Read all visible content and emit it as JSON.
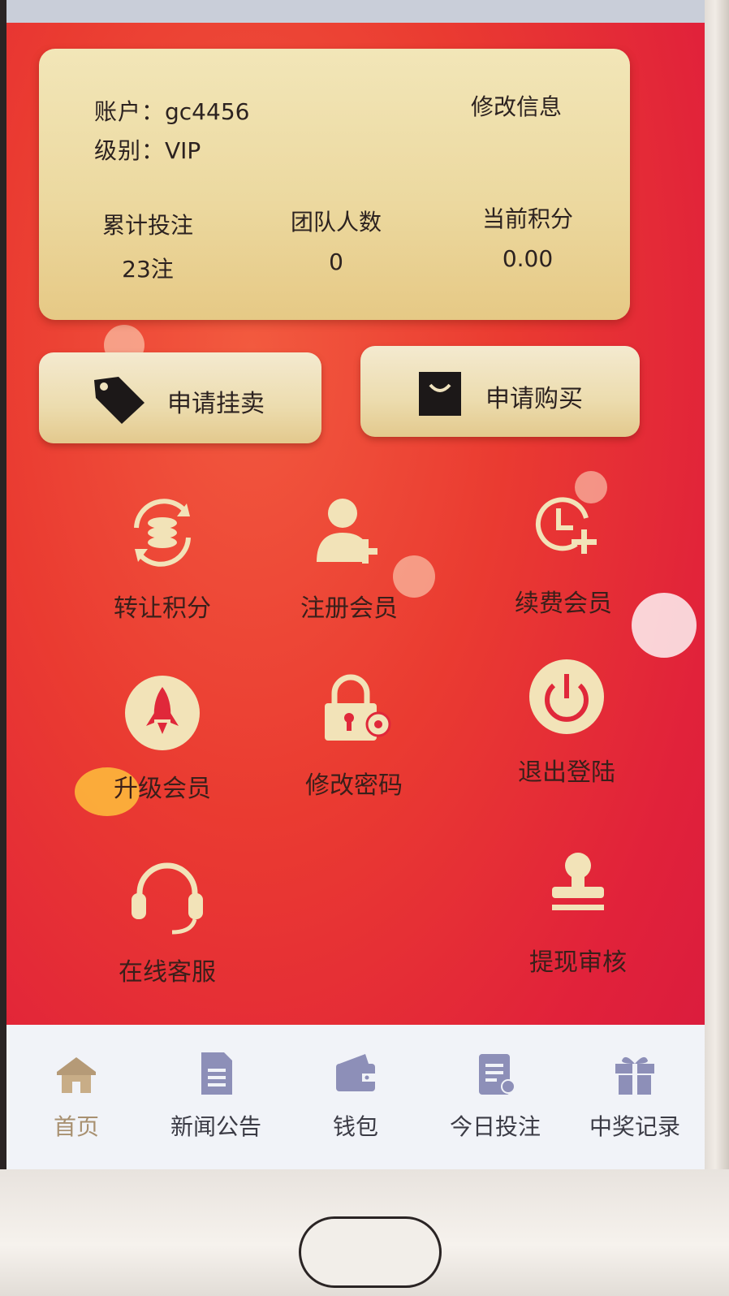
{
  "account": {
    "account_label": "账户：",
    "account_value": "gc4456",
    "level_label": "级别：",
    "level_value": "VIP",
    "edit_link": "修改信息"
  },
  "stats": [
    {
      "label": "累计投注",
      "value": "23注"
    },
    {
      "label": "团队人数",
      "value": "0"
    },
    {
      "label": "当前积分",
      "value": "0.00"
    }
  ],
  "actions": {
    "sell_label": "申请挂卖",
    "buy_label": "申请购买"
  },
  "grid": [
    {
      "label": "转让积分",
      "icon": "transfer-points-icon"
    },
    {
      "label": "注册会员",
      "icon": "register-member-icon"
    },
    {
      "label": "续费会员",
      "icon": "renew-member-icon"
    },
    {
      "label": "升级会员",
      "icon": "rocket-icon"
    },
    {
      "label": "修改密码",
      "icon": "lock-gear-icon"
    },
    {
      "label": "退出登陆",
      "icon": "power-icon"
    },
    {
      "label": "在线客服",
      "icon": "headset-icon"
    },
    {
      "label": "提现审核",
      "icon": "stamp-icon"
    }
  ],
  "nav": [
    {
      "label": "首页",
      "icon": "home-icon",
      "active": true
    },
    {
      "label": "新闻公告",
      "icon": "document-icon"
    },
    {
      "label": "钱包",
      "icon": "wallet-icon"
    },
    {
      "label": "今日投注",
      "icon": "clipboard-icon"
    },
    {
      "label": "中奖记录",
      "icon": "gift-icon"
    }
  ],
  "colors": {
    "background_red": "#e1223a",
    "card_gold": "#ecd9a0",
    "icon_cream": "#f2e3b8",
    "nav_bg": "#f1f3f8",
    "nav_active": "#a89070",
    "nav_icon": "#8d8fb8"
  }
}
